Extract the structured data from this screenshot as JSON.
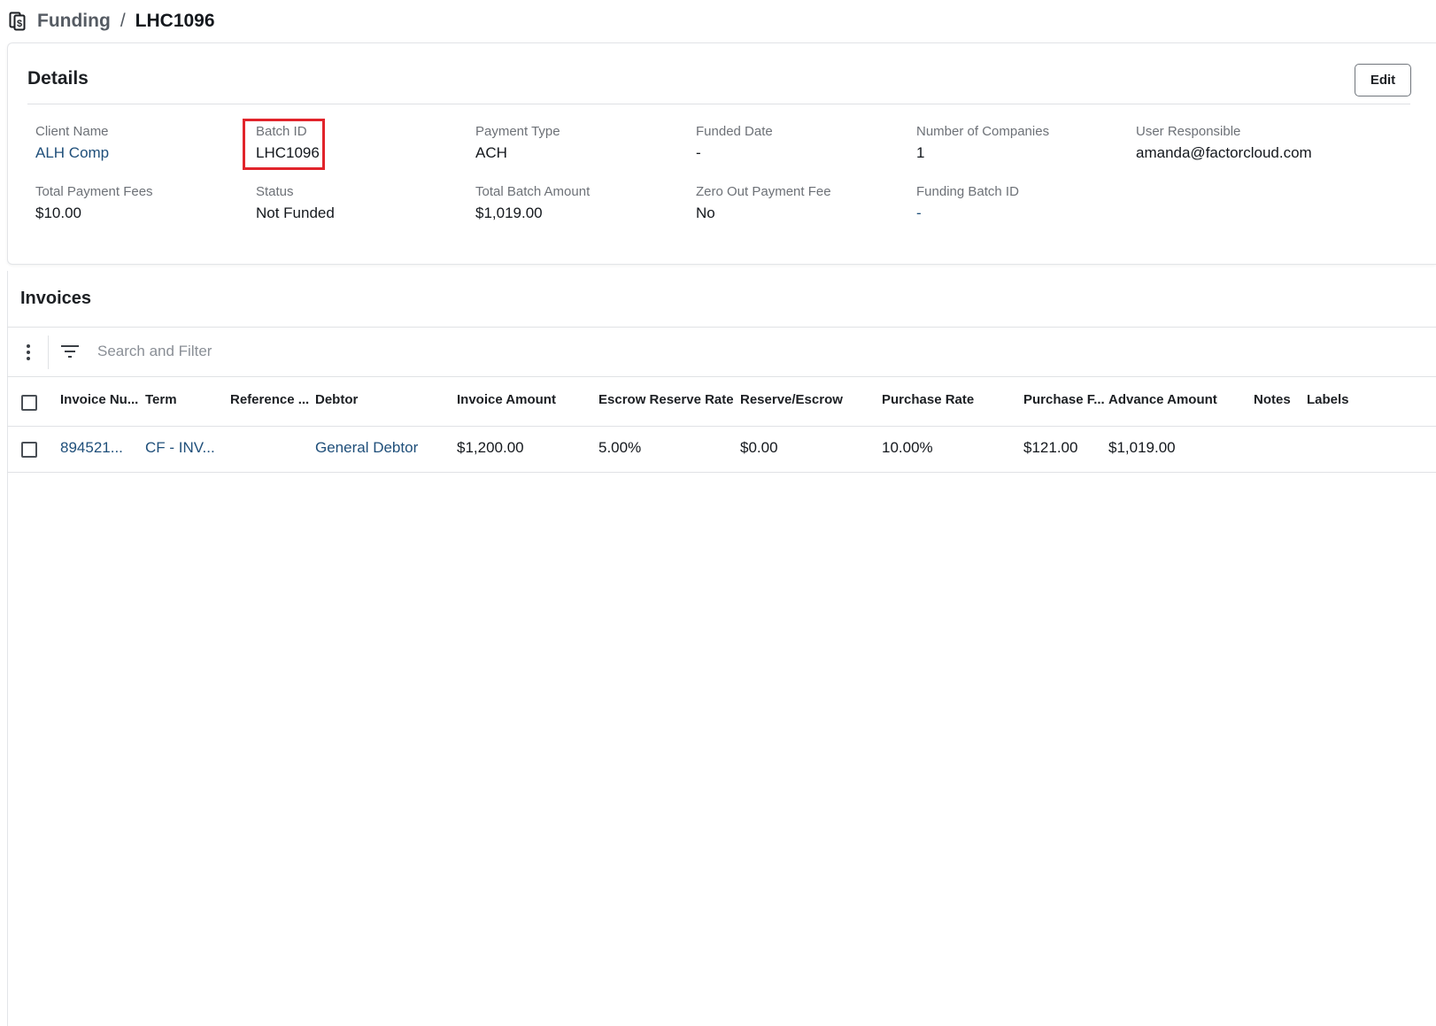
{
  "breadcrumb": {
    "parent": "Funding",
    "separator": "/",
    "current": "LHC1096"
  },
  "details": {
    "title": "Details",
    "edit_label": "Edit",
    "fields": {
      "client_name": {
        "label": "Client Name",
        "value": "ALH Comp"
      },
      "batch_id": {
        "label": "Batch ID",
        "value": "LHC1096"
      },
      "payment_type": {
        "label": "Payment Type",
        "value": "ACH"
      },
      "funded_date": {
        "label": "Funded Date",
        "value": "-"
      },
      "number_of_companies": {
        "label": "Number of Companies",
        "value": "1"
      },
      "user_responsible": {
        "label": "User Responsible",
        "value": "amanda@factorcloud.com"
      },
      "total_payment_fees": {
        "label": "Total Payment Fees",
        "value": "$10.00"
      },
      "status": {
        "label": "Status",
        "value": "Not Funded"
      },
      "total_batch_amount": {
        "label": "Total Batch Amount",
        "value": "$1,019.00"
      },
      "zero_out_payment_fee": {
        "label": "Zero Out Payment Fee",
        "value": "No"
      },
      "funding_batch_id": {
        "label": "Funding Batch ID",
        "value": "-"
      }
    }
  },
  "invoices": {
    "title": "Invoices",
    "search_placeholder": "Search and Filter",
    "columns": {
      "invoice_number": "Invoice Nu...",
      "term": "Term",
      "reference": "Reference ...",
      "debtor": "Debtor",
      "invoice_amount": "Invoice Amount",
      "escrow_reserve_rate": "Escrow Reserve Rate",
      "reserve_escrow": "Reserve/Escrow",
      "purchase_rate": "Purchase Rate",
      "purchase_fee": "Purchase F...",
      "advance_amount": "Advance Amount",
      "notes": "Notes",
      "labels": "Labels"
    },
    "rows": [
      {
        "invoice_number": "894521...",
        "term": "CF - INV...",
        "reference": "",
        "debtor": "General Debtor",
        "invoice_amount": "$1,200.00",
        "escrow_reserve_rate": "5.00%",
        "reserve_escrow": "$0.00",
        "purchase_rate": "10.00%",
        "purchase_fee": "$121.00",
        "advance_amount": "$1,019.00",
        "notes": "",
        "labels": ""
      }
    ]
  },
  "colors": {
    "link": "#1f4f7a",
    "highlight": "#e1242b"
  }
}
